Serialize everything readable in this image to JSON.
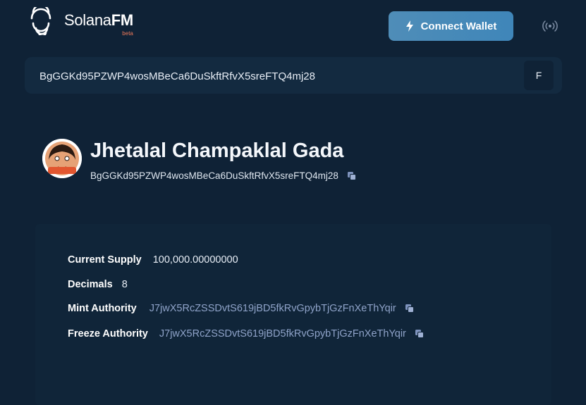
{
  "header": {
    "logo_name_regular": "Solana",
    "logo_name_bold": "FM",
    "logo_badge": "beta",
    "connect_label": "Connect Wallet",
    "icons": {
      "logo": "solanafm-logo-icon",
      "bolt": "bolt-icon",
      "network": "signal-icon"
    }
  },
  "search": {
    "value": "BgGGKd95PZWP4wosMBeCa6DuSkftRfvX5sreFTQ4mj28",
    "button_label": "F"
  },
  "profile": {
    "name": "Jhetalal Champaklal Gada",
    "address": "BgGGKd95PZWP4wosMBeCa6DuSkftRfvX5sreFTQ4mj28"
  },
  "details": {
    "supply_label": "Current Supply",
    "supply_value": "100,000.00000000",
    "decimals_label": "Decimals",
    "decimals_value": "8",
    "mint_label": "Mint Authority",
    "mint_value": "J7jwX5RcZSSDvtS619jBD5fkRvGpybTjGzFnXeThYqir",
    "freeze_label": "Freeze Authority",
    "freeze_value": "J7jwX5RcZSSDvtS619jBD5fkRvGpybTjGzFnXeThYqir"
  },
  "colors": {
    "background": "#0f2236",
    "button": "#4f8db8",
    "link": "#8fa3c9",
    "beta": "#f07a5a"
  }
}
